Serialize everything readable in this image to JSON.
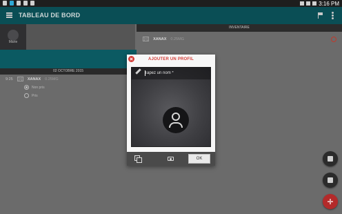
{
  "status_bar": {
    "time": "3:16 PM"
  },
  "app_bar": {
    "title": "TABLEAU DE BORD",
    "menu_icon": "menu-icon",
    "flag_icon": "flag-icon",
    "more_icon": "more-vert-icon",
    "color": "#0a4e55"
  },
  "left_panel": {
    "profile_name": "Marie",
    "date_header": "02 OCTOBRE 2015",
    "entry": {
      "time": "9:25",
      "tag": "[+]",
      "drug": "XANAX",
      "dose": "0.25MG"
    },
    "options": [
      {
        "label": "Non pris",
        "selected": true
      },
      {
        "label": "Pris",
        "selected": false
      }
    ]
  },
  "right_panel": {
    "header": "INVENTAIRE",
    "entry": {
      "tag": "[+]",
      "drug": "XANAX",
      "dose": "0.25MG"
    },
    "alarm_icon": "alarm-icon"
  },
  "dialog": {
    "title": "AJOUTER UN PROFIL",
    "name_placeholder": "Tapez un nom *",
    "ok_label": "OK",
    "accent": "#d43b36"
  },
  "fabs": [
    "medical-kit-icon",
    "add-person-icon",
    "add-icon"
  ]
}
